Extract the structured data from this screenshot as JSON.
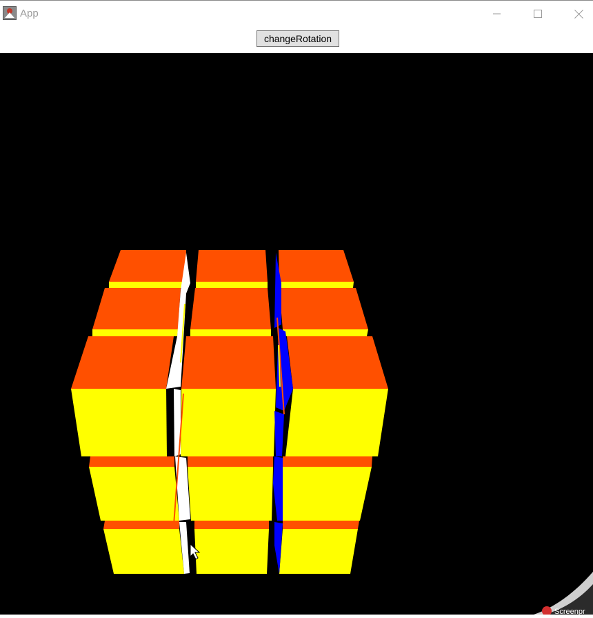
{
  "window": {
    "title": "App",
    "icon": "java-app-icon",
    "controls": [
      "minimize-icon",
      "maximize-icon",
      "close-icon"
    ]
  },
  "toolbar": {
    "button_label": "changeRotation"
  },
  "viewport": {
    "background": "#000000",
    "cube_colors": {
      "top_face": "#ff5000",
      "front_face": "#ffff00",
      "left_gap_face": "#ffffff",
      "right_gap_face": "#0000ff"
    }
  },
  "overlay": {
    "text": "Screenpr"
  }
}
